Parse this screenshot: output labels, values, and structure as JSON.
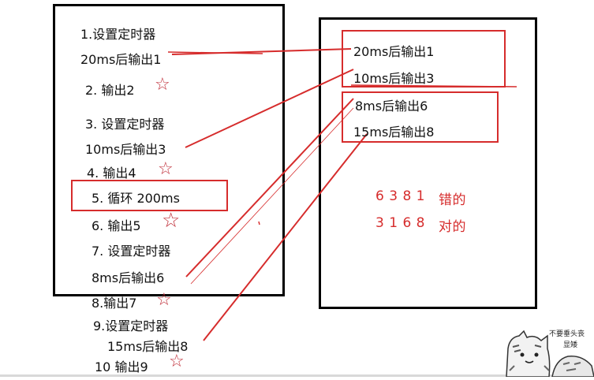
{
  "left_steps": [
    {
      "id": "s1",
      "text": "1.设置定时器"
    },
    {
      "id": "s1b",
      "text": "20ms后输出1"
    },
    {
      "id": "s2",
      "text": "2. 输出2"
    },
    {
      "id": "s3",
      "text": "3.  设置定时器"
    },
    {
      "id": "s3b",
      "text": "10ms后输出3"
    },
    {
      "id": "s4",
      "text": "4. 输出4"
    },
    {
      "id": "s5",
      "text": "5. 循环 200ms"
    },
    {
      "id": "s6",
      "text": "6. 输出5"
    },
    {
      "id": "s7",
      "text": "7. 设置定时器"
    },
    {
      "id": "s7b",
      "text": "8ms后输出6"
    },
    {
      "id": "s8",
      "text": "8.输出7"
    },
    {
      "id": "s9",
      "text": "9.设置定时器"
    },
    {
      "id": "s9b",
      "text": "15ms后输出8"
    },
    {
      "id": "s10",
      "text": "10 输出9"
    }
  ],
  "star_glyph": "☆",
  "right_outputs": [
    {
      "id": "o1",
      "text": "20ms后输出1"
    },
    {
      "id": "o2",
      "text": "10ms后输出3"
    },
    {
      "id": "o3",
      "text": "8ms后输出6"
    },
    {
      "id": "o4",
      "text": "15ms后输出8"
    }
  ],
  "answers": {
    "wrong_seq": "6 3 8 1",
    "wrong_label": "错的",
    "right_seq": "3 1 6 8",
    "right_label": "对的"
  },
  "sticker": {
    "caption_line1": "不要垂头丧",
    "caption_line2": "显矮"
  },
  "colors": {
    "accent_red": "#d62c2c",
    "star": "#c0303a",
    "border": "#000000"
  }
}
